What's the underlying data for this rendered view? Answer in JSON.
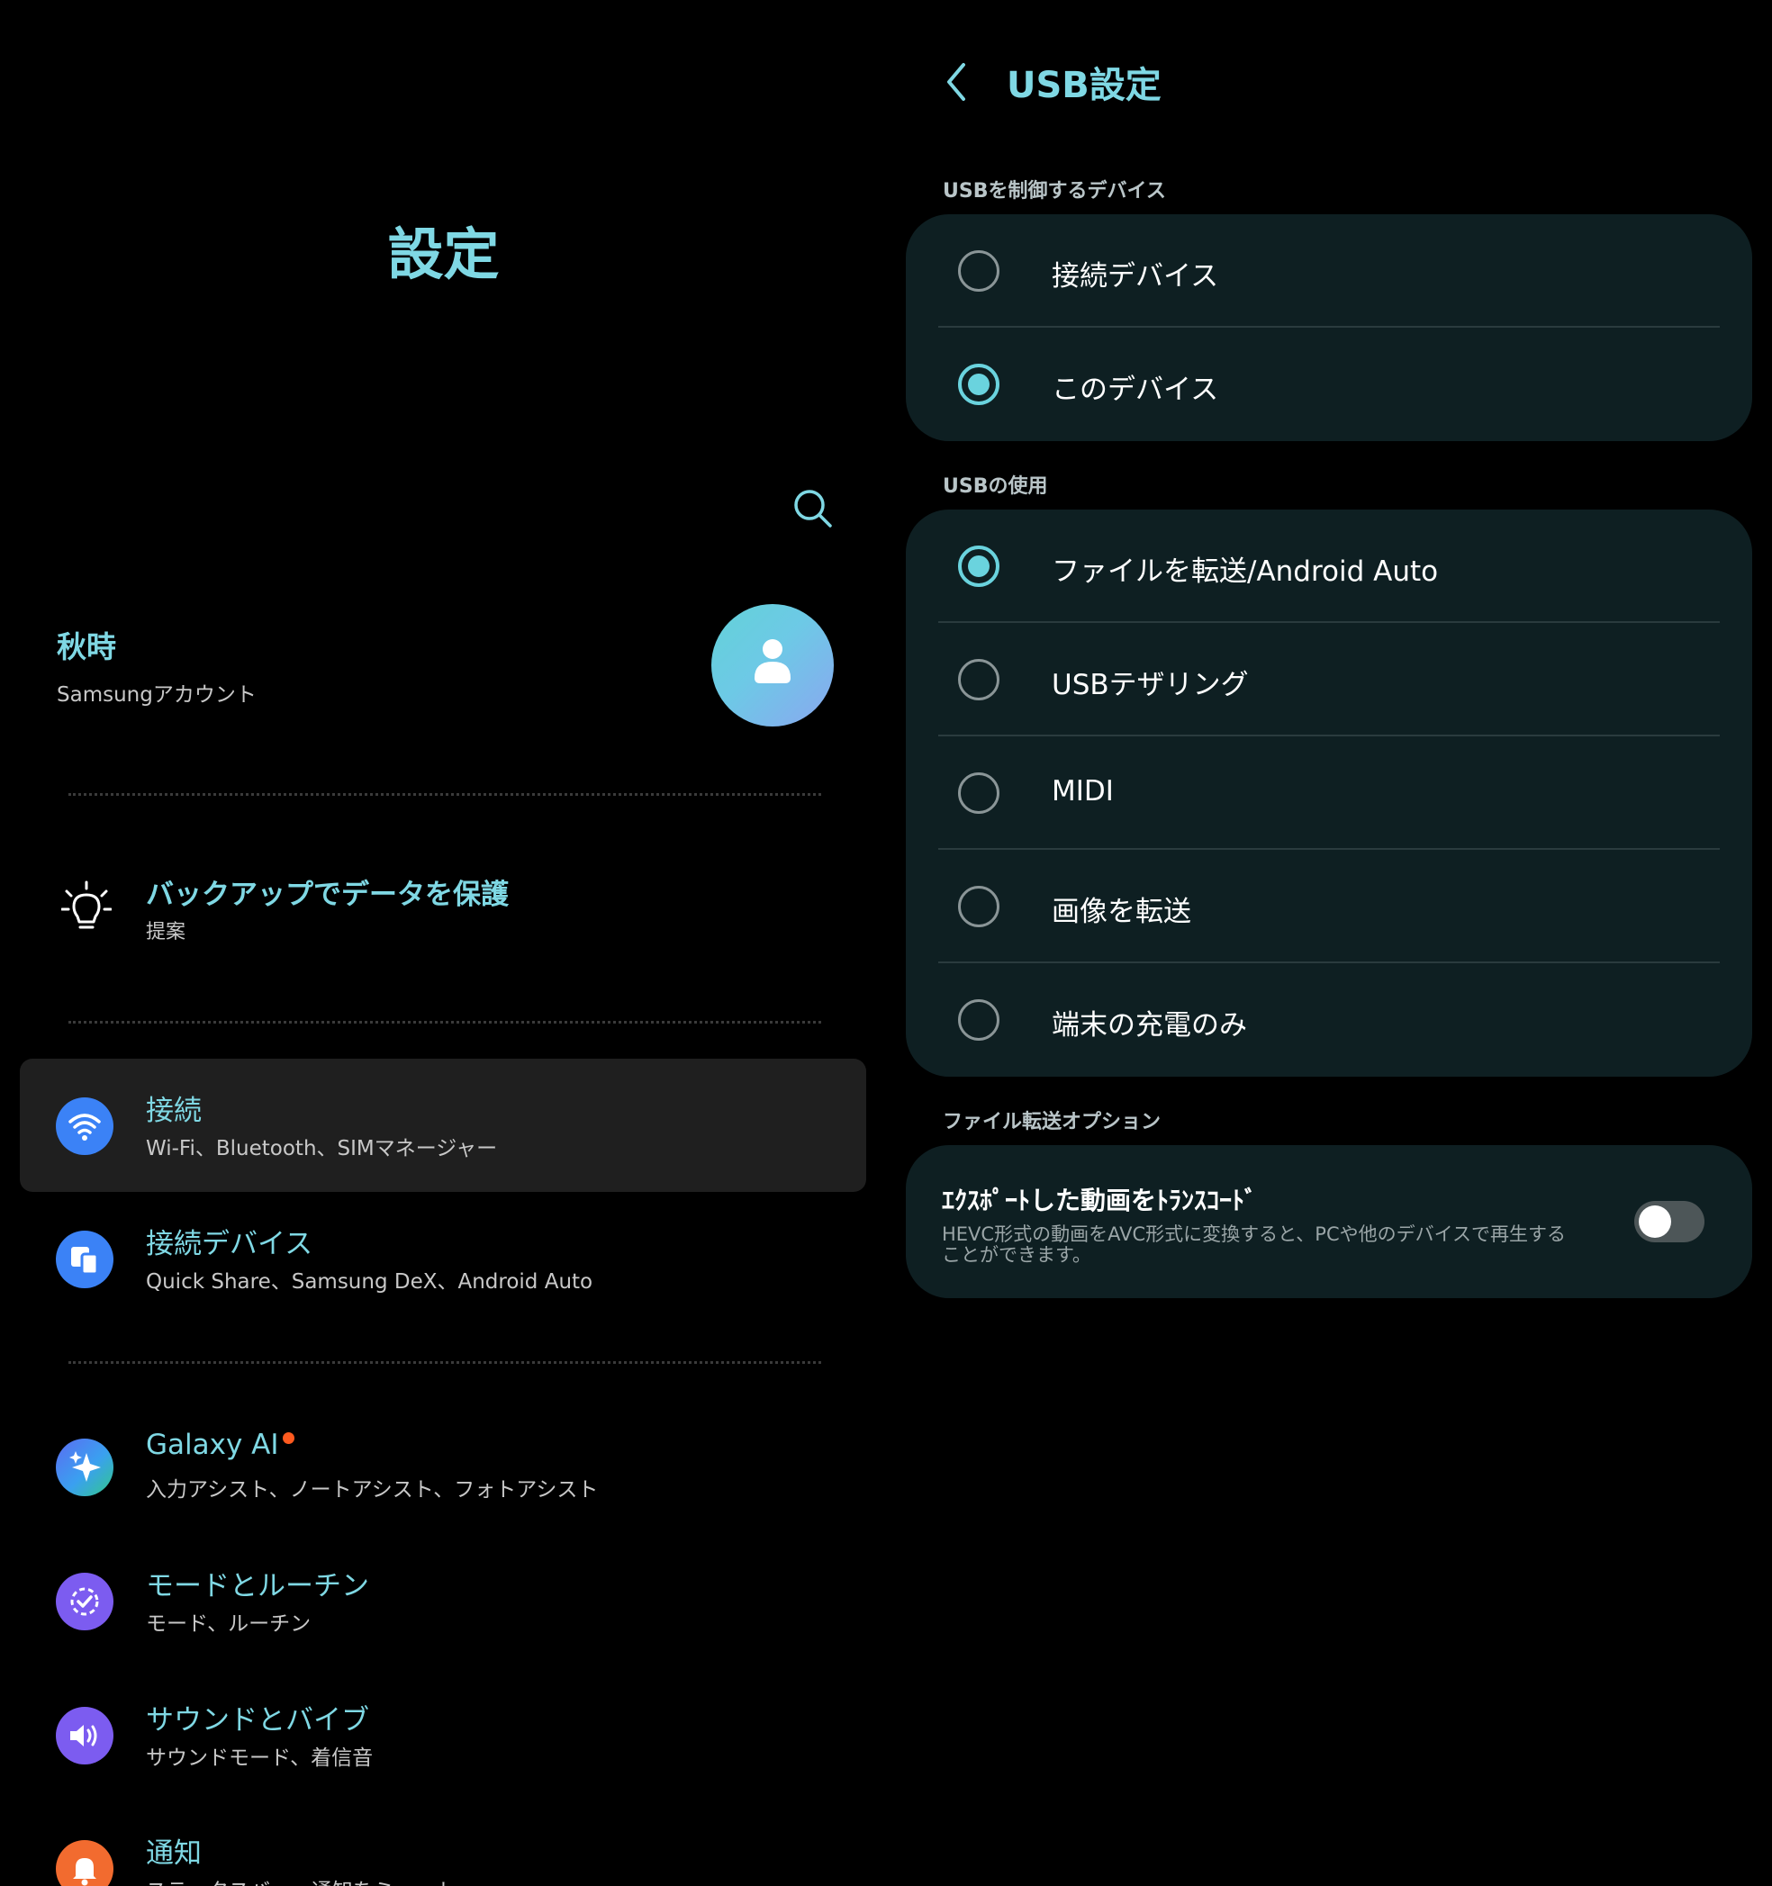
{
  "left": {
    "title": "設定",
    "profile": {
      "name": "秋時",
      "subtitle": "Samsungアカウント"
    },
    "tip": {
      "title": "バックアップでデータを保護",
      "subtitle": "提案"
    },
    "items": [
      {
        "title": "接続",
        "subtitle": "Wi-Fi、Bluetooth、SIMマネージャー",
        "icon": "wifi-icon",
        "color": "#3b82f6",
        "selected": true
      },
      {
        "title": "接続デバイス",
        "subtitle": "Quick Share、Samsung DeX、Android Auto",
        "icon": "connected-devices-icon",
        "color": "#3b82f6"
      },
      {
        "title": "Galaxy AI",
        "subtitle": "入力アシスト、ノートアシスト、フォトアシスト",
        "icon": "sparkle-icon",
        "color": "#3b82f6",
        "badge": true
      },
      {
        "title": "モードとルーチン",
        "subtitle": "モード、ルーチン",
        "icon": "routine-check-icon",
        "color": "#7c5cf0"
      },
      {
        "title": "サウンドとバイブ",
        "subtitle": "サウンドモード、着信音",
        "icon": "speaker-icon",
        "color": "#7c5cf0"
      },
      {
        "title": "通知",
        "subtitle": "ステータスバー、通知をミュート",
        "icon": "bell-icon",
        "color": "#f26b2f"
      }
    ]
  },
  "right": {
    "title": "USB設定",
    "sections": {
      "control_label": "USBを制御するデバイス",
      "control_options": [
        {
          "label": "接続デバイス",
          "selected": false
        },
        {
          "label": "このデバイス",
          "selected": true
        }
      ],
      "usage_label": "USBの使用",
      "usage_options": [
        {
          "label": "ファイルを転送/Android Auto",
          "selected": true
        },
        {
          "label": "USBテザリング",
          "selected": false
        },
        {
          "label": "MIDI",
          "selected": false
        },
        {
          "label": "画像を転送",
          "selected": false
        },
        {
          "label": "端末の充電のみ",
          "selected": false
        }
      ],
      "file_options_label": "ファイル転送オプション",
      "transcode": {
        "title": "ｴｸｽﾎﾟｰﾄした動画をﾄﾗﾝｽｺｰﾄﾞ",
        "description": "HEVC形式の動画をAVC形式に変換すると、PCや他のデバイスで再生することができます。",
        "enabled": false
      }
    }
  },
  "colors": {
    "accent": "#7fd8e4",
    "radio_on": "#6ad3de",
    "card": "#0e1f22",
    "badge": "#ff5a1f"
  }
}
